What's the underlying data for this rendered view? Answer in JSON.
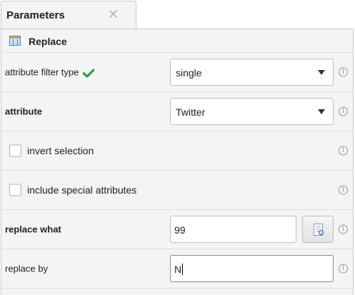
{
  "tab": {
    "title": "Parameters",
    "close_glyph": "✕"
  },
  "operator": {
    "name": "Replace",
    "icon": "replace-operator-icon"
  },
  "params": {
    "attribute_filter_type": {
      "label": "attribute filter type",
      "value": "single",
      "status_icon": "check-icon",
      "status_color": "#2e9e3f"
    },
    "attribute": {
      "label": "attribute",
      "value": "Twitter"
    },
    "invert_selection": {
      "label": "invert selection",
      "checked": false
    },
    "include_special_attributes": {
      "label": "include special attributes",
      "checked": false
    },
    "replace_what": {
      "label": "replace what",
      "value": "99"
    },
    "replace_by": {
      "label": "replace by",
      "value": "N"
    }
  },
  "info_glyph": "i"
}
